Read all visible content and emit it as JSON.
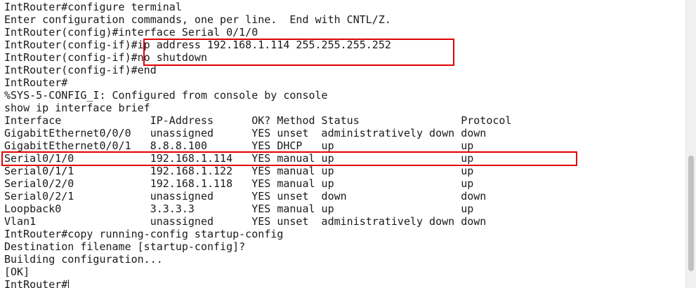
{
  "terminal": {
    "lines": [
      "IntRouter#configure terminal",
      "Enter configuration commands, one per line.  End with CNTL/Z.",
      "IntRouter(config)#interface Serial 0/1/0",
      "IntRouter(config-if)#ip address 192.168.1.114 255.255.255.252",
      "IntRouter(config-if)#no shutdown",
      "IntRouter(config-if)#end",
      "IntRouter#",
      "%SYS-5-CONFIG_I: Configured from console by console",
      "show ip interface brief",
      "Interface              IP-Address      OK? Method Status                Protocol",
      "GigabitEthernet0/0/0   unassigned      YES unset  administratively down down",
      "GigabitEthernet0/0/1   8.8.8.100       YES DHCP   up                    up",
      "Serial0/1/0            192.168.1.114   YES manual up                    up",
      "Serial0/1/1            192.168.1.122   YES manual up                    up",
      "Serial0/2/0            192.168.1.118   YES manual up                    up",
      "Serial0/2/1            unassigned      YES unset  down                  down",
      "Loopback0              3.3.3.3         YES manual up                    up",
      "Vlan1                  unassigned      YES unset  administratively down down",
      "IntRouter#copy running-config startup-config",
      "Destination filename [startup-config]?",
      "Building configuration...",
      "[OK]",
      "IntRouter#"
    ]
  },
  "colors": {
    "highlight": "#e00000",
    "text": "#1a1a1a",
    "background": "#ffffff"
  }
}
